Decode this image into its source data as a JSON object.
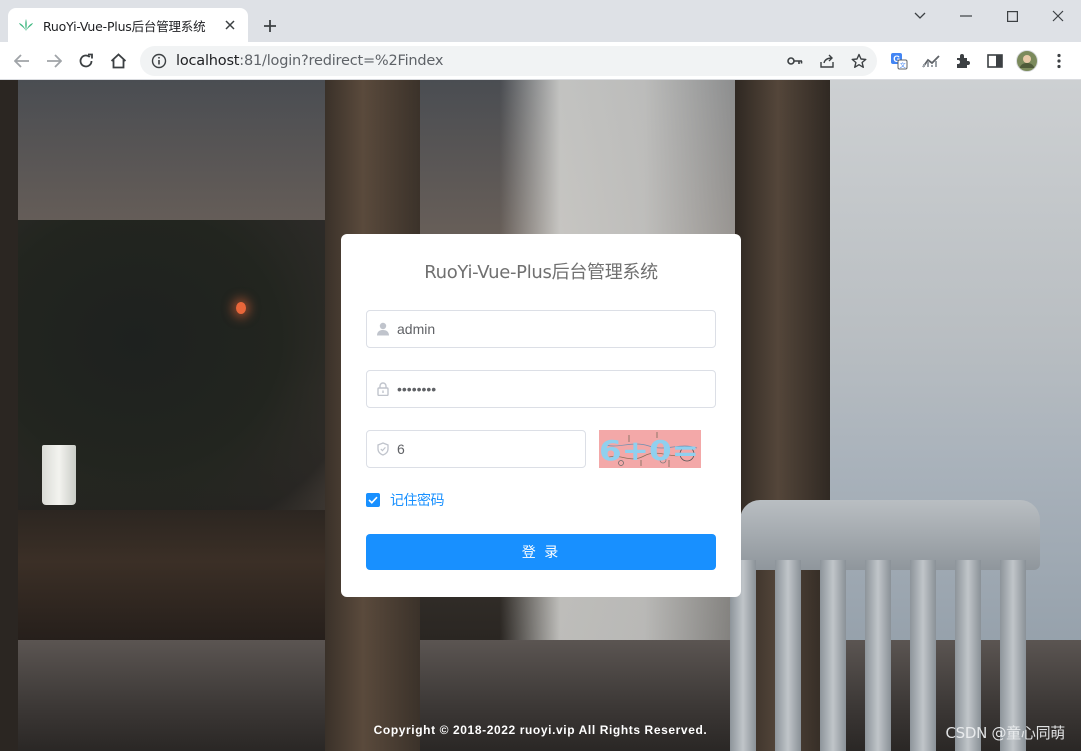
{
  "browser": {
    "tab_title": "RuoYi-Vue-Plus后台管理系统",
    "url_host": "localhost",
    "url_rest": ":81/login?redirect=%2Findex"
  },
  "login": {
    "title": "RuoYi-Vue-Plus后台管理系统",
    "username_value": "admin",
    "password_value": "••••••••",
    "code_value": "6",
    "captcha_text": "6+0=",
    "remember_label": "记住密码",
    "remember_checked": true,
    "submit_label": "登 录"
  },
  "footer": {
    "copyright": "Copyright © 2018-2022 ruoyi.vip All Rights Reserved.",
    "watermark": "CSDN @童心同萌"
  },
  "colors": {
    "primary": "#1890ff",
    "captcha_bg": "#f3a8a8"
  }
}
